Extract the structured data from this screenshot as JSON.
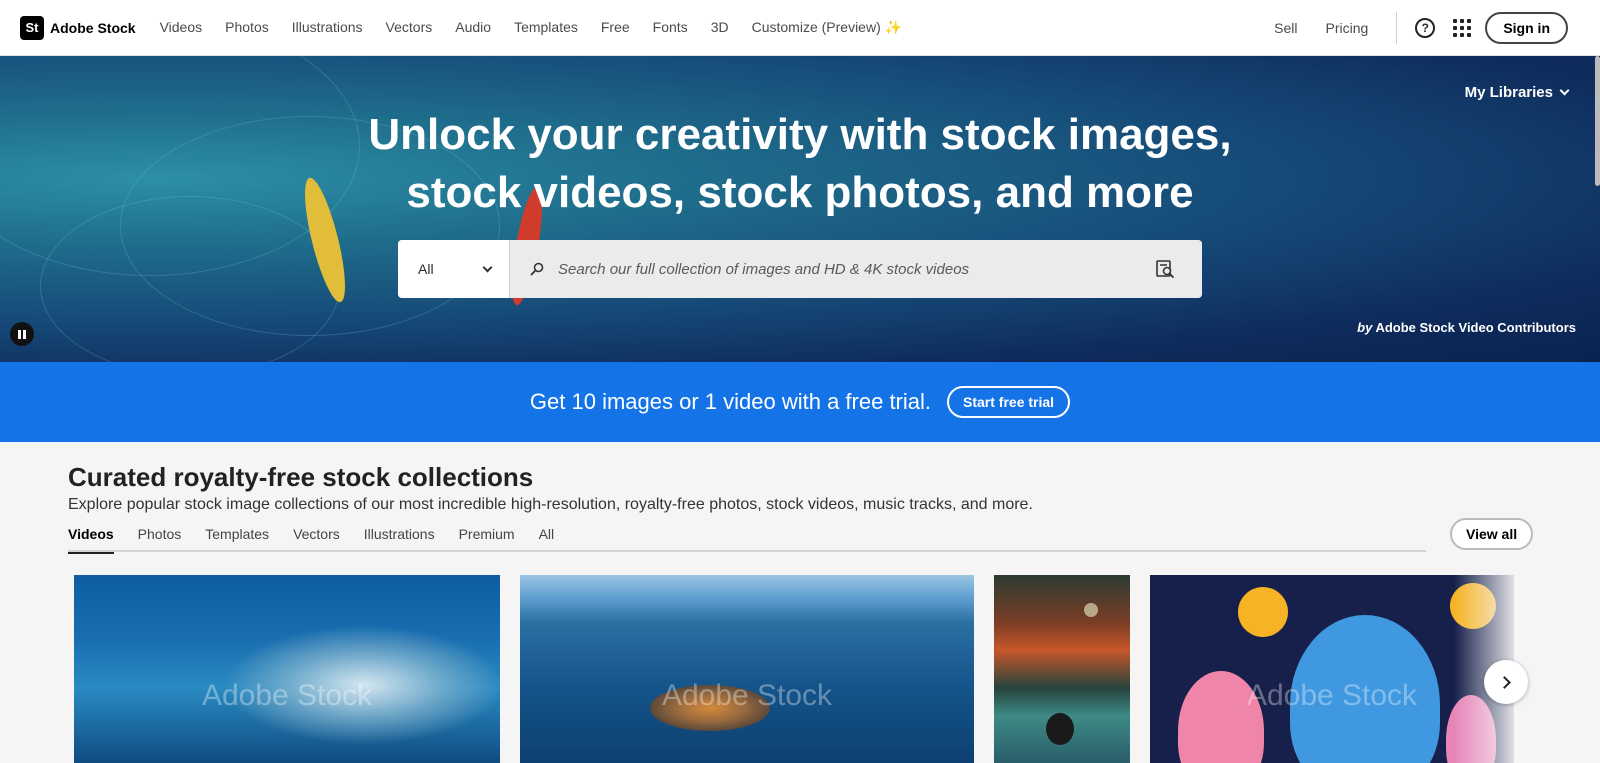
{
  "brand": {
    "logo_text": "St",
    "name": "Adobe Stock"
  },
  "nav": {
    "links": [
      "Videos",
      "Photos",
      "Illustrations",
      "Vectors",
      "Audio",
      "Templates",
      "Free",
      "Fonts",
      "3D",
      "Customize (Preview) ✨"
    ],
    "sell": "Sell",
    "pricing": "Pricing",
    "help_icon": "?",
    "signin": "Sign in"
  },
  "hero": {
    "title": "Unlock your creativity with stock images, stock videos, stock photos, and more",
    "my_libraries": "My Libraries",
    "search": {
      "category": "All",
      "placeholder": "Search our full collection of images and HD & 4K stock videos"
    },
    "attribution_by": "by",
    "attribution_name": "Adobe Stock Video Contributors"
  },
  "promo": {
    "text": "Get 10 images or 1 video with a free trial.",
    "button": "Start free trial",
    "color": "#1473e6"
  },
  "collections": {
    "title": "Curated royalty-free stock collections",
    "subtitle": "Explore popular stock image collections of our most incredible high-resolution, royalty-free photos, stock videos, music tracks, and more.",
    "tabs": [
      "Videos",
      "Photos",
      "Templates",
      "Vectors",
      "Illustrations",
      "Premium",
      "All"
    ],
    "active_tab": "Videos",
    "view_all": "View all",
    "watermark": "Adobe Stock"
  }
}
